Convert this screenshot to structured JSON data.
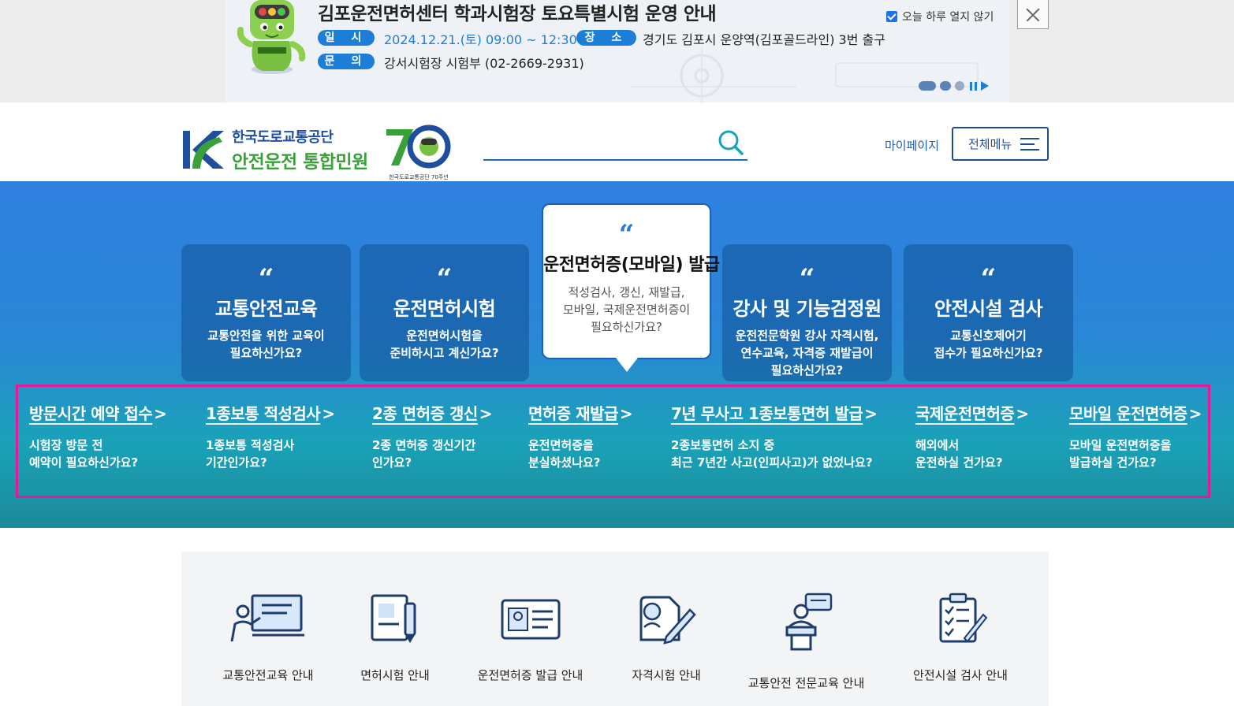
{
  "banner": {
    "title": "김포운전면허센터 학과시험장 토요특별시험 운영 안내",
    "date_label": "일 시",
    "date_value": "2024.12.21.(토) 09:00 ~ 12:30",
    "place_label": "장 소",
    "place_value": "경기도 김포시 운양역(김포골드라인) 3번 출구",
    "contact_label": "문 의",
    "contact_value": "강서시험장 시험부 (02-2669-2931)",
    "dont_show_label": "오늘 하루 열지 않기",
    "dont_show_checked": true
  },
  "header": {
    "org_name": "한국도로교통공단",
    "service_name": "안전운전 통합민원",
    "anniv_caption": "한국도로교통공단 70주년",
    "search_placeholder": "",
    "mypage_label": "마이페이지",
    "allmenu_label": "전체메뉴"
  },
  "cards": [
    {
      "title": "교통안전교육",
      "desc1": "교통안전을 위한 교육이",
      "desc2": "필요하신가요?",
      "desc3": ""
    },
    {
      "title": "운전면허시험",
      "desc1": "운전면허시험을",
      "desc2": "준비하시고 계신가요?",
      "desc3": ""
    },
    {
      "title": "운전면허증(모바일) 발급",
      "desc1": "적성검사, 갱신, 재발급,",
      "desc2": "모바일, 국제운전면허증이",
      "desc3": "필요하신가요?"
    },
    {
      "title": "강사 및 기능검정원",
      "desc1": "운전전문학원 강사 자격시험,",
      "desc2": "연수교육, 자격증 재발급이",
      "desc3": "필요하신가요?"
    },
    {
      "title": "안전시설 검사",
      "desc1": "교통신호제어기",
      "desc2": "접수가 필요하신가요?",
      "desc3": ""
    }
  ],
  "quick_links": [
    {
      "title": "방문시간 예약 접수",
      "desc1": "시험장 방문 전",
      "desc2": "예약이 필요하신가요?"
    },
    {
      "title": "1종보통 적성검사",
      "desc1": "1종보통 적성검사",
      "desc2": "기간인가요?"
    },
    {
      "title": "2종 면허증 갱신",
      "desc1": "2종 면허증 갱신기간",
      "desc2": "인가요?"
    },
    {
      "title": "면허증 재발급",
      "desc1": "운전면허증을",
      "desc2": "분실하셨나요?"
    },
    {
      "title": "7년 무사고 1종보통면허 발급",
      "desc1": "2종보통면허 소지 중",
      "desc2": "최근 7년간 사고(인피사고)가 없었나요?"
    },
    {
      "title": "국제운전면허증",
      "desc1": "해외에서",
      "desc2": "운전하실 건가요?"
    },
    {
      "title": "모바일 운전면허증",
      "desc1": "모바일 운전면허증을",
      "desc2": "발급하실 건가요?"
    }
  ],
  "quick_arrow": ">",
  "quote_mark": "“",
  "services": [
    {
      "label": "교통안전교육 안내",
      "icon": "presentation-icon"
    },
    {
      "label": "면허시험 안내",
      "icon": "document-pencil-icon"
    },
    {
      "label": "운전면허증 발급 안내",
      "icon": "id-card-icon"
    },
    {
      "label": "자격시험 안내",
      "icon": "exam-icon"
    },
    {
      "label": "교통안전 전문교육 안내",
      "icon": "lecturer-icon"
    },
    {
      "label": "안전시설 검사 안내",
      "icon": "checklist-icon"
    }
  ],
  "colors": {
    "brand_blue": "#1f4e9c",
    "brand_green": "#3aa13a",
    "accent_blue": "#1d7ed8",
    "highlight_border": "#e5179a"
  }
}
